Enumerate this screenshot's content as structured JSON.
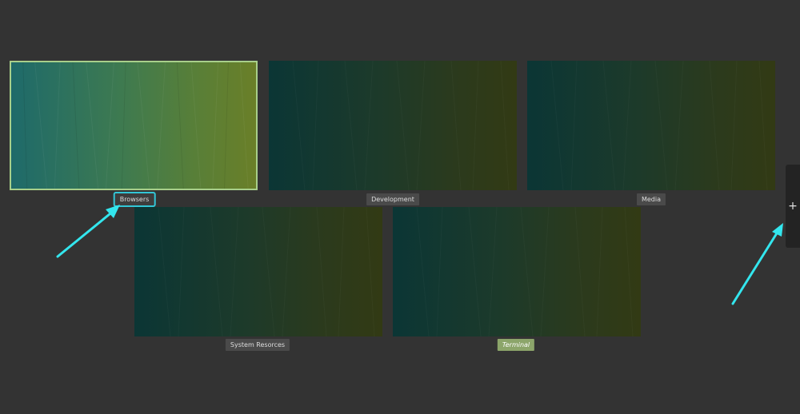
{
  "workspaces": [
    {
      "name": "Browsers",
      "active": true,
      "label_highlighted": true,
      "current": false
    },
    {
      "name": "Development",
      "active": false,
      "label_highlighted": false,
      "current": false
    },
    {
      "name": "Media",
      "active": false,
      "label_highlighted": false,
      "current": false
    },
    {
      "name": "System Resorces",
      "active": false,
      "label_highlighted": false,
      "current": false
    },
    {
      "name": "Terminal",
      "active": false,
      "label_highlighted": false,
      "current": true
    }
  ],
  "add_workspace": {
    "icon": "plus-icon",
    "glyph": "+"
  },
  "colors": {
    "background": "#333333",
    "active_border": "#a8cf8a",
    "annotation_arrow": "#33e6ee",
    "label_highlight_border": "#33c6d6",
    "current_label_bg": "#8ca56a"
  }
}
